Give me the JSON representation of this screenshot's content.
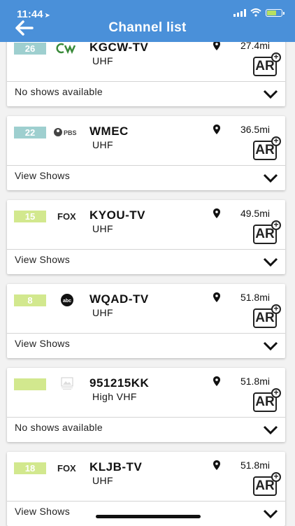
{
  "status": {
    "time": "11:44",
    "location_icon": "location-arrow-icon"
  },
  "header": {
    "title": "Channel list",
    "back_icon": "back-arrow-icon"
  },
  "colors": {
    "header": "#4a90d9",
    "badge_teal": "#9ecfcf",
    "badge_green": "#d2e88e"
  },
  "channels": [
    {
      "number": "26",
      "logo": "cw-logo",
      "callsign": "KGCW-TV",
      "band": "UHF",
      "distance": "27.4mi",
      "footer": "No shows available",
      "badge_color": "#9ecfcf"
    },
    {
      "number": "22",
      "logo": "pbs-logo",
      "logo_text": "PBS",
      "callsign": "WMEC",
      "band": "UHF",
      "distance": "36.5mi",
      "footer": "View Shows",
      "badge_color": "#9ecfcf"
    },
    {
      "number": "15",
      "logo": "fox-logo",
      "logo_text": "FOX",
      "callsign": "KYOU-TV",
      "band": "UHF",
      "distance": "49.5mi",
      "footer": "View Shows",
      "badge_color": "#d2e88e"
    },
    {
      "number": "8",
      "logo": "abc-logo",
      "logo_text": "abc",
      "callsign": "WQAD-TV",
      "band": "UHF",
      "distance": "51.8mi",
      "footer": "View Shows",
      "badge_color": "#d2e88e"
    },
    {
      "number": "",
      "logo": "image-placeholder-icon",
      "callsign": "951215KK",
      "band": "High VHF",
      "distance": "51.8mi",
      "footer": "No shows available",
      "badge_color": "#d2e88e"
    },
    {
      "number": "18",
      "logo": "fox-logo",
      "logo_text": "FOX",
      "callsign": "KLJB-TV",
      "band": "UHF",
      "distance": "51.8mi",
      "footer": "View Shows",
      "badge_color": "#d2e88e"
    }
  ],
  "ar_label": "AR"
}
